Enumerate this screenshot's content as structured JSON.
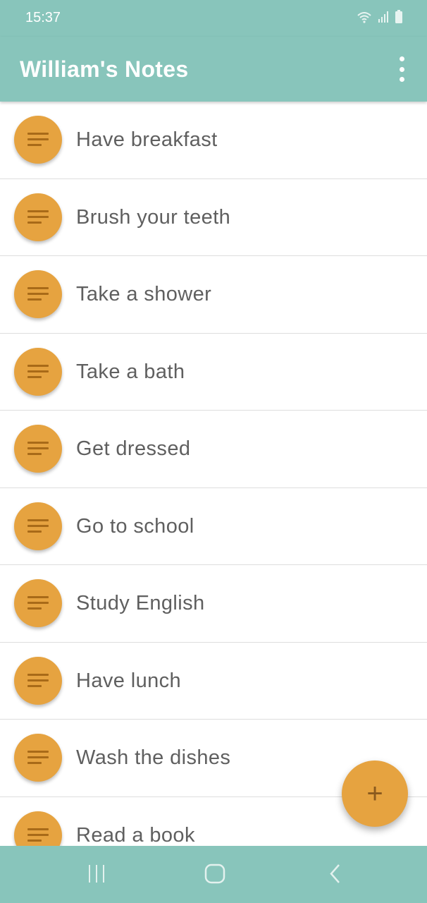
{
  "status_bar": {
    "time": "15:37",
    "icons": [
      "wifi-icon",
      "signal-icon",
      "battery-icon"
    ]
  },
  "app_bar": {
    "title": "William's Notes",
    "menu_icon": "more-vert-icon"
  },
  "notes": [
    {
      "label": "Have breakfast",
      "icon": "notes-icon"
    },
    {
      "label": "Brush your teeth",
      "icon": "notes-icon"
    },
    {
      "label": "Take a shower",
      "icon": "notes-icon"
    },
    {
      "label": "Take a bath",
      "icon": "notes-icon"
    },
    {
      "label": "Get dressed",
      "icon": "notes-icon"
    },
    {
      "label": "Go to school",
      "icon": "notes-icon"
    },
    {
      "label": "Study English",
      "icon": "notes-icon"
    },
    {
      "label": "Have lunch",
      "icon": "notes-icon"
    },
    {
      "label": "Wash the dishes",
      "icon": "notes-icon"
    },
    {
      "label": "Read a book",
      "icon": "notes-icon"
    }
  ],
  "fab": {
    "symbol": "+",
    "icon": "add-icon"
  },
  "nav_bar": {
    "buttons": [
      "recents-icon",
      "home-icon",
      "back-icon"
    ]
  },
  "colors": {
    "primary": "#88c5bb",
    "accent": "#e6a340",
    "icon_lines": "#a86a18",
    "text": "#5f5f5f",
    "divider": "#dedede"
  }
}
